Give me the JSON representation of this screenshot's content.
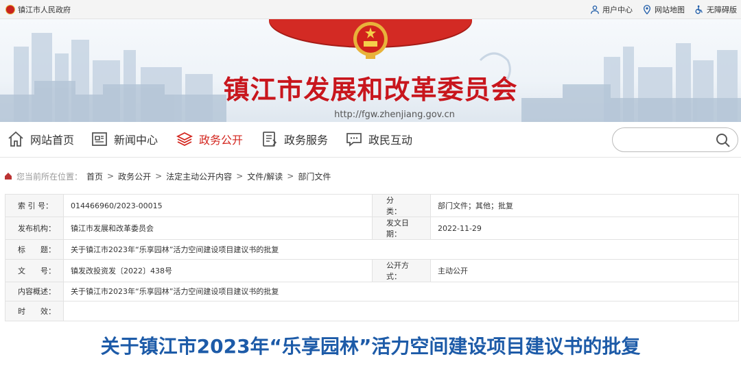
{
  "topbar": {
    "home_label": "镇江市人民政府",
    "user_center": "用户中心",
    "site_map": "网站地图",
    "accessible": "无障碍版"
  },
  "banner": {
    "title": "镇江市发展和改革委员会",
    "url": "http://fgw.zhenjiang.gov.cn"
  },
  "nav": {
    "items": [
      {
        "label": "网站首页",
        "icon": "home-icon"
      },
      {
        "label": "新闻中心",
        "icon": "news-icon"
      },
      {
        "label": "政务公开",
        "icon": "layers-icon"
      },
      {
        "label": "政务服务",
        "icon": "service-icon"
      },
      {
        "label": "政民互动",
        "icon": "chat-icon"
      }
    ],
    "active": "政务公开",
    "active_color": "#d3251e",
    "search_placeholder": ""
  },
  "breadcrumb": {
    "lead": "您当前所在位置：",
    "items": [
      "首页",
      "政务公开",
      "法定主动公开内容",
      "文件/解读",
      "部门文件"
    ]
  },
  "info": {
    "rows": [
      {
        "k1": "索 引 号：",
        "v1": "014466960/2023-00015",
        "k2": "分　　类：",
        "v2": "部门文件；其他；批复"
      },
      {
        "k1": "发布机构：",
        "v1": "镇江市发展和改革委员会",
        "k2": "发文日期：",
        "v2": "2022-11-29"
      },
      {
        "k1": "标　　题：",
        "v1": "关于镇江市2023年“乐享园林”活力空间建设项目建议书的批复"
      },
      {
        "k1": "文　　号：",
        "v1": "镇发改投资发〔2022〕438号",
        "k2": "公开方式：",
        "v2": "主动公开"
      },
      {
        "k1": "内容概述：",
        "v1": "关于镇江市2023年“乐享园林”活力空间建设项目建议书的批复"
      },
      {
        "k1": "时　　效：",
        "v1": ""
      }
    ]
  },
  "document": {
    "title": "关于镇江市2023年“乐享园林”活力空间建设项目建议书的批复",
    "title_color": "#1d5ba8"
  },
  "colors": {
    "brand_red": "#c8161d",
    "ribbon_red": "#d32a24"
  }
}
